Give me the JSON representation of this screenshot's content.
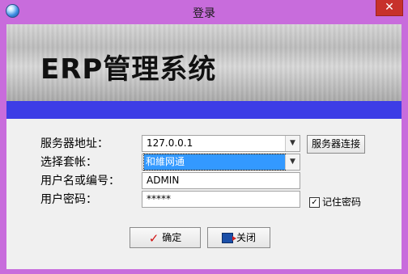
{
  "window": {
    "title": "登录",
    "close_glyph": "✕",
    "app_icon": "globe-icon"
  },
  "banner": {
    "title": "ERP管理系统"
  },
  "form": {
    "server_label": "服务器地址：",
    "server_value": "127.0.0.1",
    "server_connect_button": "服务器连接",
    "account_label": "选择套帐：",
    "account_value": "和維网通",
    "user_label": "用户名或编号：",
    "user_value": "ADMIN",
    "password_label": "用户密码：",
    "password_value": "*****",
    "remember_label": "记住密码",
    "remember_checked": true
  },
  "buttons": {
    "ok_label": "确定",
    "close_label": "关闭"
  },
  "colors": {
    "window_frame": "#c86cdc",
    "banner_bar": "#3d3de6",
    "close_button": "#c7312b",
    "selection": "#3399ff"
  }
}
